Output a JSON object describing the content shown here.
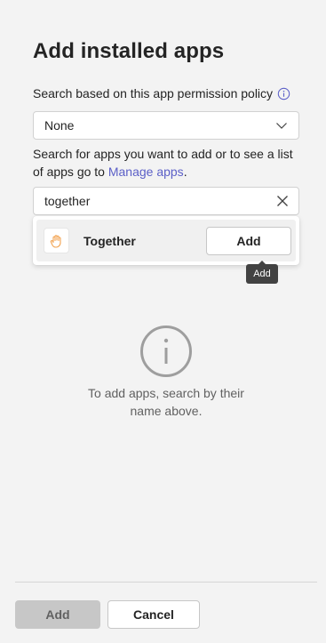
{
  "title": "Add installed apps",
  "policy": {
    "label": "Search based on this app permission policy",
    "info_icon": "info-icon",
    "selected": "None"
  },
  "helper": {
    "text": "Search for apps you want to add or to see a list of apps go to ",
    "link": "Manage apps",
    "suffix": "."
  },
  "search": {
    "value": "together",
    "placeholder": ""
  },
  "results": [
    {
      "name": "Together",
      "icon": "hand-wave-icon",
      "add_label": "Add"
    }
  ],
  "tooltip": "Add",
  "empty": {
    "icon": "info-icon",
    "text": "To add apps, search by their name above."
  },
  "footer": {
    "add_label": "Add",
    "cancel_label": "Cancel"
  },
  "colors": {
    "background": "#f3f3f3",
    "link": "#5b5fc7",
    "app_icon": "#f2a350",
    "disabled_button": "#c7c7c7",
    "tooltip": "#424242"
  }
}
